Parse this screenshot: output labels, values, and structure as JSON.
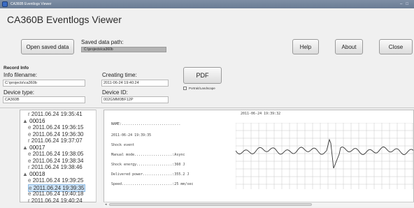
{
  "window": {
    "title": "CA360B Eventlogs Viewer",
    "controls": [
      "–",
      "□"
    ]
  },
  "app_title": "CA360B Eventlogs Viewer",
  "toolbar": {
    "open_label": "Open saved data",
    "saved_path_label": "Saved data path:",
    "saved_path_value": "C:\\projects\\ca360b",
    "help_label": "Help",
    "about_label": "About",
    "close_label": "Close"
  },
  "record": {
    "section_label": "Record Info",
    "info_filename_label": "Info filename:",
    "info_filename_value": "C:\\projects\\ca360b",
    "creating_time_label": "Creating time:",
    "creating_time_value": "2011-06-24 19:40:24",
    "device_type_label": "Device type:",
    "device_type_value": "CA360B",
    "device_id_label": "Device ID:",
    "device_id_value": "002GMM0BF12P",
    "pdf_label": "PDF",
    "portrait_label": "Portrait/Landscape"
  },
  "tree": {
    "items": [
      {
        "prefix": "r",
        "text": "2011.06.24 19:35:41",
        "folder": false,
        "selected": false
      },
      {
        "prefix": "▲",
        "text": "00016",
        "folder": true,
        "selected": false
      },
      {
        "prefix": "e",
        "text": "2011.06.24 19:36:15",
        "folder": false,
        "selected": false
      },
      {
        "prefix": "e",
        "text": "2011.06.24 19:36:30",
        "folder": false,
        "selected": false
      },
      {
        "prefix": "r",
        "text": "2011.06.24 19:37:07",
        "folder": false,
        "selected": false
      },
      {
        "prefix": "▲",
        "text": "00017",
        "folder": true,
        "selected": false
      },
      {
        "prefix": "e",
        "text": "2011.06.24 19:38:05",
        "folder": false,
        "selected": false
      },
      {
        "prefix": "e",
        "text": "2011.06.24 19:38:34",
        "folder": false,
        "selected": false
      },
      {
        "prefix": "r",
        "text": "2011.06.24 19:38:46",
        "folder": false,
        "selected": false
      },
      {
        "prefix": "▲",
        "text": "00018",
        "folder": true,
        "selected": false
      },
      {
        "prefix": "e",
        "text": "2011.06.24 19:39:25",
        "folder": false,
        "selected": false
      },
      {
        "prefix": "e",
        "text": "2011.06.24 19:39:35",
        "folder": false,
        "selected": true
      },
      {
        "prefix": "e",
        "text": "2011.06.24 19:40:18",
        "folder": false,
        "selected": false
      },
      {
        "prefix": "r",
        "text": "2011.06.24 19:40:24",
        "folder": false,
        "selected": false
      }
    ]
  },
  "detail": {
    "lines": [
      "NAME:............................",
      "2011-06-24 19:39:35",
      "Shock event",
      "Manual mode..................:Async",
      "Shock energy.................:360 J",
      "Delivered power..............:355.2 J",
      "Speed........................:25 mm/sec"
    ],
    "ecg_timestamp": "2011-06-24 19:39:32"
  },
  "colors": {
    "selection": "#cde3f7",
    "grid": "#c8c8c8",
    "trace": "#333333"
  }
}
